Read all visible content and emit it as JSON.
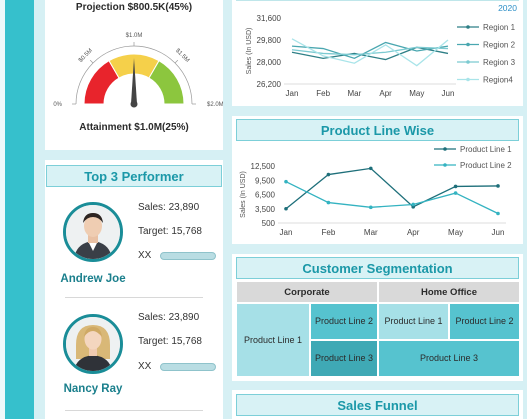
{
  "gauge": {
    "projection": "Projection $800.5K(45%)",
    "attainment": "Attainment $1.0M(25%)",
    "scale_labels": [
      "0%",
      "$0.5M",
      "$1.0M",
      "$1.5M",
      "$2.0M"
    ],
    "colors": {
      "low": "#e8242c",
      "mid": "#f5d04a",
      "high": "#8cc63e"
    },
    "needle_fraction": 0.5
  },
  "performers": {
    "title": "Top 3 Performer",
    "items": [
      {
        "name": "Andrew Joe",
        "sales": "Sales: 23,890",
        "target": "Target: 15,768",
        "xx": "XX"
      },
      {
        "name": "Nancy Ray",
        "sales": "Sales: 23,890",
        "target": "Target: 15,768",
        "xx": "XX"
      }
    ]
  },
  "region_chart": {
    "year_label": "2020",
    "ylabel": "Sales (In USD)",
    "categories": [
      "Jan",
      "Feb",
      "Mar",
      "Apr",
      "May",
      "Jun"
    ],
    "yticks": [
      "31,600",
      "29,800",
      "28,000",
      "26,200"
    ],
    "ylim": [
      26200,
      31600
    ],
    "series": [
      {
        "name": "Region 1",
        "color": "#2e7f86",
        "values": [
          28800,
          28300,
          28700,
          28200,
          29200,
          28700
        ]
      },
      {
        "name": "Region 2",
        "color": "#4aa7b0",
        "values": [
          29300,
          29100,
          28300,
          29600,
          28900,
          29300
        ]
      },
      {
        "name": "Region 3",
        "color": "#7ccad1",
        "values": [
          29000,
          28700,
          28600,
          28800,
          29200,
          29100
        ]
      },
      {
        "name": "Region4",
        "color": "#a9e4e9",
        "values": [
          29900,
          28500,
          27900,
          29400,
          27700,
          29800
        ]
      }
    ]
  },
  "product_line": {
    "title": "Product Line Wise",
    "ylabel": "Sales (In USD)",
    "categories": [
      "Jan",
      "Feb",
      "Mar",
      "Apr",
      "May",
      "Jun"
    ],
    "yticks": [
      "12,500",
      "9,500",
      "6,500",
      "3,500",
      "500"
    ],
    "ylim": [
      500,
      12500
    ],
    "series": [
      {
        "name": "Product Line 1",
        "color": "#1e6f7a",
        "values": [
          3500,
          10700,
          12000,
          3900,
          8200,
          8300
        ]
      },
      {
        "name": "Product Line 2",
        "color": "#34b3c1",
        "values": [
          9200,
          4800,
          3800,
          4400,
          6800,
          2500
        ]
      }
    ]
  },
  "segmentation": {
    "title": "Customer Segmentation",
    "headers": [
      "Corporate",
      "Home Office"
    ],
    "cells": [
      "Product Line 1",
      "Product Line 2",
      "Product Line 3",
      "Product Line 1",
      "Product Line 2",
      "Product  Line 3"
    ]
  },
  "funnel": {
    "title": "Sales Funnel"
  }
}
